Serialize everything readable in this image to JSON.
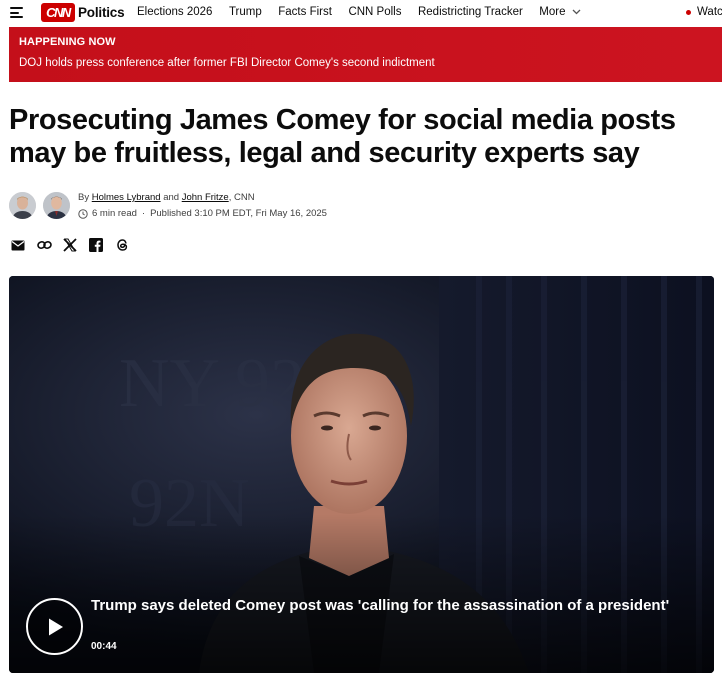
{
  "nav": {
    "logo": "CNN",
    "section": "Politics",
    "links": [
      "Elections 2026",
      "Trump",
      "Facts First",
      "CNN Polls",
      "Redistricting Tracker"
    ],
    "more_label": "More",
    "watch_label": "Watch"
  },
  "banner": {
    "kicker": "HAPPENING NOW",
    "text": "DOJ holds press conference after former FBI Director Comey's second indictment"
  },
  "article": {
    "headline": "Prosecuting James Comey for social media posts may be fruitless, legal and security experts say",
    "byline_prefix": "By",
    "authors": [
      "Holmes Lybrand",
      "John Fritze"
    ],
    "byline_and": "and",
    "byline_suffix": ", CNN",
    "read_time": "6 min read",
    "published": "Published 3:10 PM EDT, Fri May 16, 2025"
  },
  "share": [
    "email-icon",
    "link-icon",
    "x-icon",
    "facebook-icon",
    "threads-icon"
  ],
  "video": {
    "title": "Trump says deleted Comey post was 'calling for the assassination of a president'",
    "duration": "00:44"
  },
  "colors": {
    "brand_red": "#cc0000",
    "banner_red": "#c8121d",
    "text": "#0c0c0c"
  }
}
